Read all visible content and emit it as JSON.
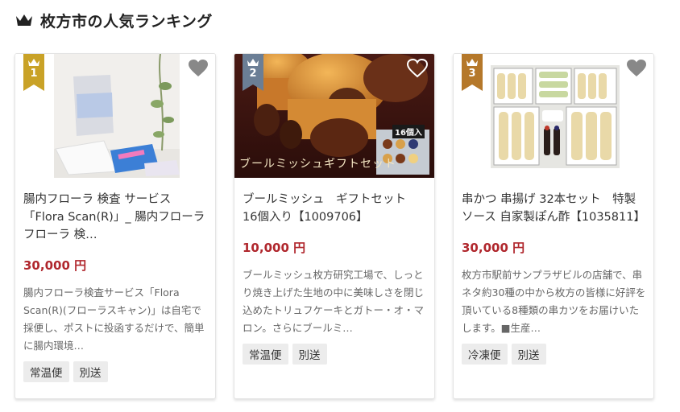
{
  "header": {
    "title": "枚方市の人気ランキング",
    "icon": "crown-icon"
  },
  "colors": {
    "gold": "#c9a227",
    "silver": "#6b7e95",
    "bronze": "#b5782a",
    "price": "#b0272d"
  },
  "cards": [
    {
      "rank": "1",
      "title": "腸内フローラ 検査 サービス「Flora Scan(R)」_ 腸内フローラ フローラ 検…",
      "price": "30,000 円",
      "description": "腸内フローラ検査サービス「Flora Scan(R)(フローラスキャン)」は自宅で採便し、ポストに投函するだけで、簡単に腸内環境…",
      "tags": [
        "常温便",
        "別送"
      ]
    },
    {
      "rank": "2",
      "title": "ブールミッシュ　ギフトセット　16個入り【1009706】",
      "price": "10,000 円",
      "image_caption": "ブールミッシュギフトセット",
      "image_badge": "16個入",
      "description": "ブールミッシュ枚方研究工場で、しっとり焼き上げた生地の中に美味しさを閉じ込めたトリュフケーキとガトー・オ・マロン。さらにブールミ…",
      "tags": [
        "常温便",
        "別送"
      ]
    },
    {
      "rank": "3",
      "title": "串かつ 串揚げ 32本セット　特製ソース 自家製ぽん酢【1035811】",
      "price": "30,000 円",
      "description": "枚方市駅前サンプラザビルの店舗で、串ネタ約30種の中から枚方の皆様に好評を頂いている8種類の串カツをお届けいたします。■生産…",
      "tags": [
        "冷凍便",
        "別送"
      ]
    }
  ]
}
